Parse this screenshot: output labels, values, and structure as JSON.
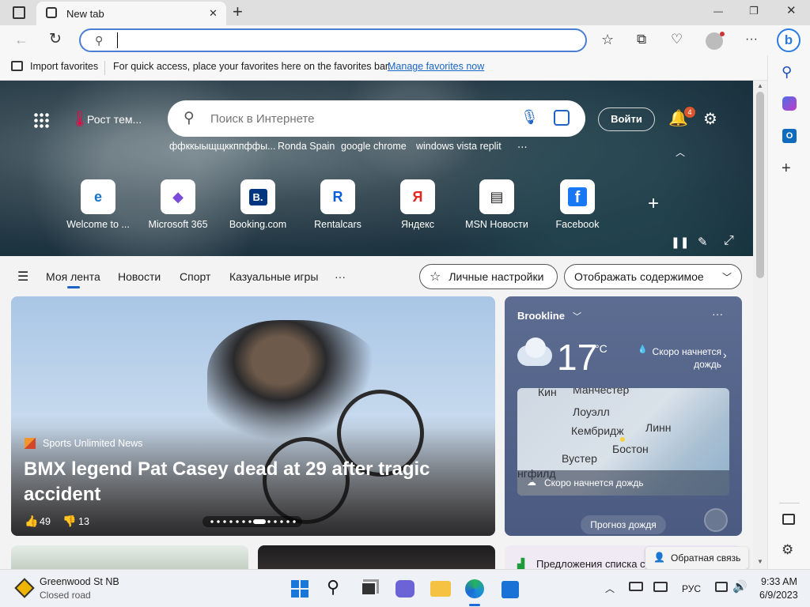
{
  "tab": {
    "title": "New tab",
    "close": "✕",
    "new": "+"
  },
  "window": {
    "minimize": "—",
    "restore": "❐",
    "close": "✕"
  },
  "address": {
    "value": "",
    "placeholder": ""
  },
  "favorites_bar": {
    "import_label": "Import favorites",
    "message": "For quick access, place your favorites here on the favorites bar.",
    "manage_link": "Manage favorites now"
  },
  "msn": {
    "weather_chip": "Рост тем...",
    "search_placeholder": "Поиск в Интернете",
    "signin": "Войти",
    "notif_count": "4",
    "trending": [
      "ффккыыщщккппффы...",
      "Ronda Spain",
      "google chrome",
      "windows vista replit",
      "⋯"
    ],
    "quick_links": [
      {
        "label": "Welcome to ...",
        "glyph": "e",
        "color": "#1b73c7"
      },
      {
        "label": "Microsoft 365",
        "glyph": "◆",
        "color": "#7b4ad8"
      },
      {
        "label": "Booking.com",
        "glyph": "B.",
        "color": "#003580"
      },
      {
        "label": "Rentalcars",
        "glyph": "R",
        "color": "#0b5fd6"
      },
      {
        "label": "Яндекс",
        "glyph": "Я",
        "color": "#e52620"
      },
      {
        "label": "MSN Новости",
        "glyph": "▤",
        "color": "#222"
      },
      {
        "label": "Facebook",
        "glyph": "f",
        "color": "#1877f2"
      }
    ],
    "add_site": "+",
    "feed_tabs": [
      "Моя лента",
      "Новости",
      "Спорт",
      "Казуальные игры",
      "···"
    ],
    "personalize": "Личные настройки",
    "content_toggle": "Отображать содержимое"
  },
  "story": {
    "source": "Sports Unlimited News",
    "headline": "BMX legend Pat Casey dead at 29 after tragic accident",
    "likes": "49",
    "dislikes": "13"
  },
  "weather": {
    "location": "Brookline",
    "temp": "17",
    "unit": "°C",
    "rain_note": "Скоро начнется дождь",
    "map_cities": [
      "Кин",
      "Манчестер",
      "Лоуэлл",
      "Кембридж",
      "Линн",
      "Бостон",
      "Вустер",
      "нгфилд"
    ],
    "map_banner": "Скоро начнется дождь",
    "forecast_button": "Прогноз дождя"
  },
  "bottom": {
    "suggestion": "Предложения списка статей",
    "feedback": "Обратная связь"
  },
  "taskbar": {
    "traffic_title": "Greenwood St NB",
    "traffic_sub": "Closed road",
    "lang": "РУС",
    "time": "9:33 AM",
    "date": "6/9/2023"
  }
}
